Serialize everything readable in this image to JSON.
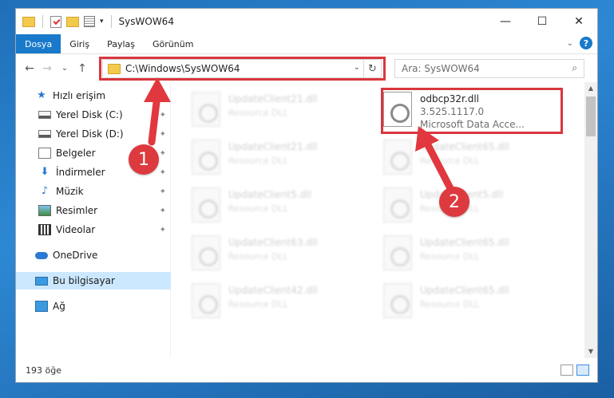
{
  "window": {
    "title": "SysWOW64",
    "controls": {
      "minimize": "—",
      "maximize": "☐",
      "close": "✕"
    }
  },
  "ribbon": {
    "tabs": [
      {
        "label": "Dosya",
        "active": true
      },
      {
        "label": "Giriş"
      },
      {
        "label": "Paylaş"
      },
      {
        "label": "Görünüm"
      }
    ],
    "help": "?",
    "collapse": "⌄"
  },
  "nav": {
    "back": "←",
    "forward": "→",
    "recent": "⌄",
    "up": "↑",
    "address": "C:\\Windows\\SysWOW64",
    "address_dropdown": "⌄",
    "refresh": "↻",
    "search_placeholder": "Ara: SysWOW64",
    "search_icon": "magnifier-icon"
  },
  "sidebar": {
    "items": [
      {
        "label": "Hızlı erişim",
        "icon": "star-icon",
        "pinned": false
      },
      {
        "label": "Yerel Disk (C:)",
        "icon": "disk-icon",
        "pinned": true
      },
      {
        "label": "Yerel Disk (D:)",
        "icon": "disk-icon",
        "pinned": true
      },
      {
        "label": "Belgeler",
        "icon": "documents-icon",
        "pinned": true
      },
      {
        "label": "İndirmeler",
        "icon": "downloads-icon",
        "pinned": true
      },
      {
        "label": "Müzik",
        "icon": "music-icon",
        "pinned": true
      },
      {
        "label": "Resimler",
        "icon": "pictures-icon",
        "pinned": true
      },
      {
        "label": "Videolar",
        "icon": "videos-icon",
        "pinned": true
      },
      {
        "label": "OneDrive",
        "icon": "cloud-icon",
        "pinned": false
      },
      {
        "label": "Bu bilgisayar",
        "icon": "computer-icon",
        "pinned": false,
        "selected": true
      },
      {
        "label": "Ağ",
        "icon": "network-icon",
        "pinned": false
      }
    ],
    "pin_glyph": "📌"
  },
  "files": [
    {
      "name": "UpdateClient21.dll",
      "type": "Resource DLL"
    },
    {
      "name": "odbcp32r.dll",
      "version": "3.525.1117.0",
      "description": "Microsoft Data Acce...",
      "highlighted": true
    },
    {
      "name": "UpdateClient21.dll",
      "type": "Resource DLL"
    },
    {
      "name": "UpdateClient65.dll",
      "type": "Resource DLL"
    },
    {
      "name": "UpdateClient5.dll",
      "type": "Resource DLL"
    },
    {
      "name": "UpdateClient5.dll",
      "type": "Resource DLL"
    },
    {
      "name": "UpdateClient63.dll",
      "type": "Resource DLL"
    },
    {
      "name": "UpdateClient65.dll",
      "type": "Resource DLL"
    },
    {
      "name": "UpdateClient42.dll",
      "type": "Resource DLL"
    },
    {
      "name": "UpdateClient65.dll",
      "type": "Resource DLL"
    }
  ],
  "status": {
    "item_count": "193 öğe"
  },
  "annotations": {
    "badge_1": "1",
    "badge_2": "2",
    "color": "#d9363e"
  }
}
